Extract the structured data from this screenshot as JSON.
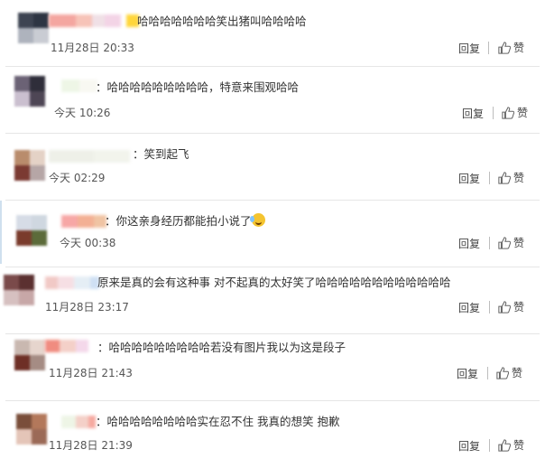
{
  "comments": [
    {
      "text": "哈哈哈哈哈哈哈笑出猪叫哈哈哈哈",
      "time": "11月28日 20:33",
      "reply": "回复",
      "like": "赞",
      "avatar_colors": [
        "#3d4452",
        "#2d3543",
        "#aeb3bd",
        "#c9ccd3"
      ],
      "name_colors": [
        "#f4a6a0",
        "#f7c3b8",
        "#f0e0e6",
        "#f3d4e6",
        "#ffffff",
        "#ffd63a"
      ]
    },
    {
      "text": "：哈哈哈哈哈哈哈哈哈，特意来围观哈哈",
      "time": "今天 10:26",
      "reply": "回复",
      "like": "赞",
      "avatar_colors": [
        "#6b6275",
        "#2f2e3a",
        "#cabfcf",
        "#4e4655"
      ],
      "name_colors": [
        "#eef6e6",
        "#f8f8f2"
      ]
    },
    {
      "text": "：笑到起飞",
      "time": "今天 02:29",
      "reply": "回复",
      "like": "赞",
      "avatar_colors": [
        "#b98c6c",
        "#e4d2c6",
        "#7b3a32",
        "#b6a6a6"
      ],
      "name_colors": [
        "#eef0e8",
        "#f2f4ec"
      ]
    },
    {
      "text": "：你这亲身经历都能拍小说了",
      "time": "今天 00:38",
      "reply": "回复",
      "like": "赞",
      "avatar_colors": [
        "#d6dce6",
        "#cfd7e0",
        "#7a3b2c",
        "#5c6b3a"
      ],
      "name_colors": [
        "#f7a7a6",
        "#f3b094",
        "#f0c4a3"
      ]
    },
    {
      "text": "原来是真的会有这种事 对不起真的太好笑了哈哈哈哈哈哈哈哈哈哈哈哈",
      "time": "11月28日 23:17",
      "reply": "回复",
      "like": "赞",
      "avatar_colors": [
        "#7a4a4a",
        "#5b3030",
        "#d6c0c0",
        "#c7a7a7"
      ],
      "name_colors": [
        "#f1c9c6",
        "#f6dfe4",
        "#e5eef5",
        "#cfe0f4"
      ]
    },
    {
      "text": "：哈哈哈哈哈哈哈哈哈若没有图片我以为这是段子",
      "time": "11月28日 21:43",
      "reply": "回复",
      "like": "赞",
      "avatar_colors": [
        "#c9b8b0",
        "#e6d5cd",
        "#6e2f26",
        "#a58c84"
      ],
      "name_colors": [
        "#f08c80",
        "#f4d0c8",
        "#f4d8ea",
        "#ffffff"
      ]
    },
    {
      "text": "：哈哈哈哈哈哈哈哈实在忍不住 我真的想笑 抱歉",
      "time": "11月28日 21:39",
      "reply": "回复",
      "like": "赞",
      "avatar_colors": [
        "#7a4e3a",
        "#b3785b",
        "#e4c5b8",
        "#9b6a57"
      ],
      "name_colors": [
        "#eef5e6",
        "#f4d0c8",
        "#f6a9a0"
      ]
    }
  ]
}
